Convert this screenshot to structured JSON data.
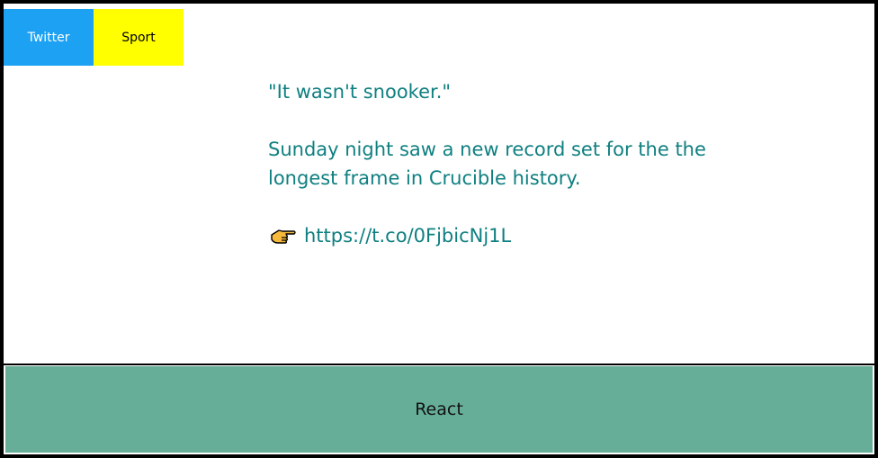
{
  "tags": {
    "source_label": "Twitter",
    "category_label": "Sport"
  },
  "tweet": {
    "quote": "\"It wasn't snooker.\"",
    "body": "Sunday night saw a new record set for the the longest frame in Crucible history.",
    "link_icon": "pointing-hand-icon",
    "link_text": "https://t.co/0FjbicNj1L"
  },
  "action": {
    "react_label": "React"
  },
  "colors": {
    "source_tag_bg": "#1da1f2",
    "category_tag_bg": "#ffff00",
    "text_accent": "#0f7f80",
    "react_bar_bg": "#67ae99",
    "frame": "#000000"
  }
}
